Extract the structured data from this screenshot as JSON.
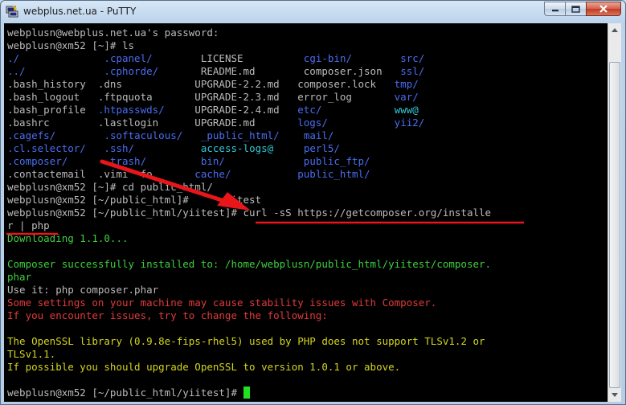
{
  "window": {
    "title": "webplus.net.ua - PuTTY",
    "controls": [
      "minimize",
      "maximize",
      "close"
    ]
  },
  "colors": {
    "terminal_bg": "#000000",
    "default_text": "#bbbbbb",
    "directory": "#4a6df0",
    "link": "#30c8d8",
    "success": "#3fd03f",
    "warning": "#e23a3a",
    "notice": "#d4d41e",
    "cursor": "#22e022",
    "annotation": "#e8151b"
  },
  "terminal": {
    "lines": [
      [
        {
          "t": "webplusn@webplus.net.ua's password:",
          "c": "white"
        }
      ],
      [
        {
          "t": "webplusn@xm52 [~]# ls",
          "c": "white"
        }
      ],
      [
        {
          "t": "./",
          "c": "blue"
        },
        {
          "t": "              ",
          "c": "white"
        },
        {
          "t": ".cpanel/",
          "c": "blue"
        },
        {
          "t": "        LICENSE          ",
          "c": "white"
        },
        {
          "t": "cgi-bin/",
          "c": "blue"
        },
        {
          "t": "        ",
          "c": "white"
        },
        {
          "t": "src/",
          "c": "blue"
        }
      ],
      [
        {
          "t": "../",
          "c": "blue"
        },
        {
          "t": "             ",
          "c": "white"
        },
        {
          "t": ".cphorde/",
          "c": "blue"
        },
        {
          "t": "       README.md        composer.json   ",
          "c": "white"
        },
        {
          "t": "ssl/",
          "c": "blue"
        }
      ],
      [
        {
          "t": ".bash_history  .dns            UPGRADE-2.2.md   composer.lock   ",
          "c": "white"
        },
        {
          "t": "tmp/",
          "c": "blue"
        }
      ],
      [
        {
          "t": ".bash_logout   .ftpquota       UPGRADE-2.3.md   error_log       ",
          "c": "white"
        },
        {
          "t": "var/",
          "c": "blue"
        }
      ],
      [
        {
          "t": ".bash_profile  ",
          "c": "white"
        },
        {
          "t": ".htpasswds/",
          "c": "blue"
        },
        {
          "t": "     UPGRADE-2.4.md   ",
          "c": "white"
        },
        {
          "t": "etc/",
          "c": "blue"
        },
        {
          "t": "            ",
          "c": "white"
        },
        {
          "t": "www@",
          "c": "cyan"
        }
      ],
      [
        {
          "t": ".bashrc        .lastlogin      UPGRADE.md       ",
          "c": "white"
        },
        {
          "t": "logs/",
          "c": "blue"
        },
        {
          "t": "           ",
          "c": "white"
        },
        {
          "t": "yii2/",
          "c": "blue"
        }
      ],
      [
        {
          "t": ".cagefs/",
          "c": "blue"
        },
        {
          "t": "        ",
          "c": "white"
        },
        {
          "t": ".softaculous/",
          "c": "blue"
        },
        {
          "t": "   ",
          "c": "white"
        },
        {
          "t": "_public_html/",
          "c": "blue"
        },
        {
          "t": "    ",
          "c": "white"
        },
        {
          "t": "mail/",
          "c": "blue"
        }
      ],
      [
        {
          "t": ".cl.selector/",
          "c": "blue"
        },
        {
          "t": "   ",
          "c": "white"
        },
        {
          "t": ".ssh/",
          "c": "blue"
        },
        {
          "t": "           ",
          "c": "white"
        },
        {
          "t": "access-logs@",
          "c": "cyan"
        },
        {
          "t": "     ",
          "c": "white"
        },
        {
          "t": "perl5/",
          "c": "blue"
        }
      ],
      [
        {
          "t": ".composer/",
          "c": "blue"
        },
        {
          "t": "      ",
          "c": "white"
        },
        {
          "t": ".trash/",
          "c": "blue"
        },
        {
          "t": "         ",
          "c": "white"
        },
        {
          "t": "bin/",
          "c": "blue"
        },
        {
          "t": "             ",
          "c": "white"
        },
        {
          "t": "public_ftp/",
          "c": "blue"
        }
      ],
      [
        {
          "t": ".contactemail  .vimi  fo       ",
          "c": "white"
        },
        {
          "t": "cache/",
          "c": "blue"
        },
        {
          "t": "           ",
          "c": "white"
        },
        {
          "t": "public_html/",
          "c": "blue"
        }
      ],
      [
        {
          "t": "webplusn@xm52 [~]# cd public_html/",
          "c": "white"
        }
      ],
      [
        {
          "t": "webplusn@xm52 [~/public_html]#     yiitest",
          "c": "white"
        }
      ],
      [
        {
          "t": "webplusn@xm52 [~/public_html/yiitest]# curl -sS https://getcomposer.org/installe",
          "c": "white"
        }
      ],
      [
        {
          "t": "r | php",
          "c": "white"
        }
      ],
      [
        {
          "t": "Downloading 1.1.0...",
          "c": "green"
        }
      ],
      [
        {
          "t": "",
          "c": "white"
        }
      ],
      [
        {
          "t": "Composer successfully installed to: /home/webplusn/public_html/yiitest/composer.",
          "c": "green"
        }
      ],
      [
        {
          "t": "phar",
          "c": "green"
        }
      ],
      [
        {
          "t": "Use it: php composer.phar",
          "c": "white"
        }
      ],
      [
        {
          "t": "Some settings on your machine may cause stability issues with Composer.",
          "c": "red"
        }
      ],
      [
        {
          "t": "If you encounter issues, try to change the following:",
          "c": "red"
        }
      ],
      [
        {
          "t": "",
          "c": "white"
        }
      ],
      [
        {
          "t": "The OpenSSL library (0.9.8e-fips-rhel5) used by PHP does not support TLSv1.2 or",
          "c": "yellow"
        }
      ],
      [
        {
          "t": "TLSv1.1.",
          "c": "yellow"
        }
      ],
      [
        {
          "t": "If possible you should upgrade OpenSSL to version 1.0.1 or above.",
          "c": "yellow"
        }
      ],
      [
        {
          "t": "",
          "c": "white"
        }
      ],
      [
        {
          "t": "webplusn@xm52 [~/public_html/yiitest]# ",
          "c": "white"
        }
      ]
    ],
    "cursor_line": 28
  },
  "scrollbar": {
    "position_fraction": 1.0,
    "visible_fraction": 0.93
  },
  "annotation": {
    "icon": "red-arrow-icon",
    "description_shapes": [
      "arrow",
      "underline-command",
      "underline-continuation"
    ]
  }
}
